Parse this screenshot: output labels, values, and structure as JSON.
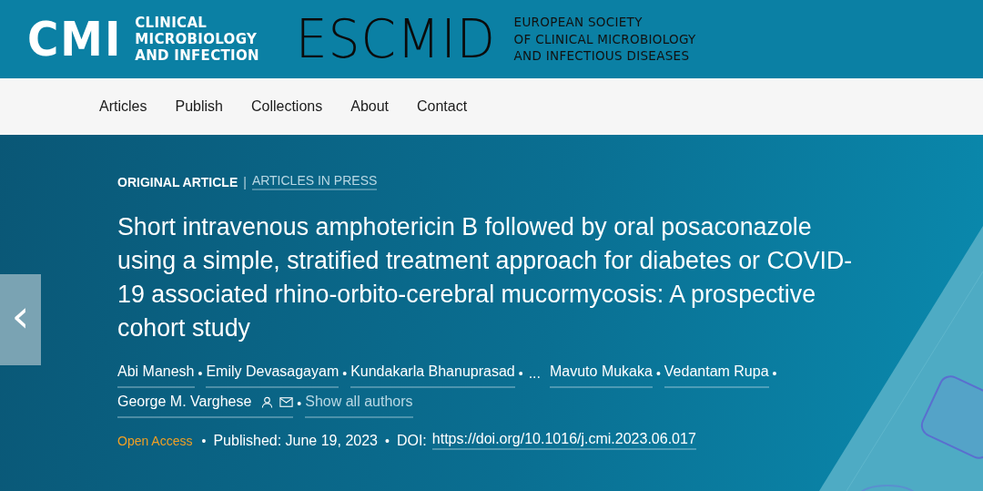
{
  "header": {
    "journal_logo": {
      "mark": "CMI",
      "lines": [
        "CLINICAL",
        "MICROBIOLOGY",
        "AND INFECTION"
      ]
    },
    "society_logo": {
      "mark": "ESCMID",
      "lines": [
        "EUROPEAN SOCIETY",
        "OF CLINICAL MICROBIOLOGY",
        "AND INFECTIOUS DISEASES"
      ]
    }
  },
  "nav": {
    "items": [
      {
        "label": "Articles"
      },
      {
        "label": "Publish"
      },
      {
        "label": "Collections"
      },
      {
        "label": "About"
      },
      {
        "label": "Contact"
      }
    ]
  },
  "article": {
    "type": "ORIGINAL ARTICLE",
    "separator": "|",
    "section_link": "ARTICLES IN PRESS",
    "title": "Short intravenous amphotericin B followed by oral posaconazole using a simple, stratified treatment approach for diabetes or COVID-19 associated rhino-orbito-cerebral mucormycosis: A prospective cohort study",
    "authors": [
      {
        "kind": "author",
        "name": "Abi Manesh",
        "bullet": "•"
      },
      {
        "kind": "author",
        "name": "Emily Devasagayam",
        "bullet": "•"
      },
      {
        "kind": "author",
        "name": "Kundakarla Bhanuprasad",
        "bullet": "•"
      },
      {
        "kind": "ellipsis",
        "name": "..."
      },
      {
        "kind": "author",
        "name": "Mavuto Mukaka",
        "bullet": "•"
      },
      {
        "kind": "author",
        "name": "Vedantam Rupa",
        "bullet": "•"
      },
      {
        "kind": "corresponding",
        "name": "George M. Varghese",
        "bullet": "•"
      },
      {
        "kind": "more",
        "name": "Show all authors"
      }
    ],
    "meta": {
      "access": "Open Access",
      "bullet_1": "•",
      "published": "Published: June 19, 2023",
      "bullet_2": "•",
      "doi_label": "DOI:",
      "doi": "https://doi.org/10.1016/j.cmi.2023.06.017"
    }
  },
  "carousel": {
    "prev": "‹"
  }
}
